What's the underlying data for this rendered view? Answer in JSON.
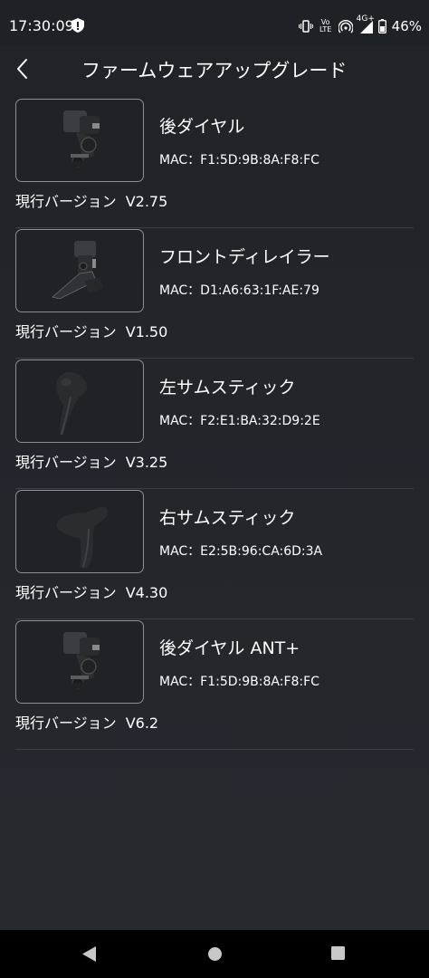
{
  "status_bar": {
    "time": "17:30:09",
    "network": "4G+",
    "volte": "Vo LTE",
    "battery": "46%",
    "icons": [
      "shield-alert-icon",
      "vibrate-icon",
      "volte-icon",
      "hotspot-icon",
      "signal-icon",
      "battery-icon"
    ]
  },
  "header": {
    "title": "ファームウェアアップグレード",
    "back_icon": "chevron-left-icon"
  },
  "devices": [
    {
      "name": "後ダイヤル",
      "mac": "MAC：F1:5D:9B:8A:F8:FC",
      "version_label": "現行バージョン",
      "version": "V2.75",
      "image": "rear-derailleur-image"
    },
    {
      "name": "フロントディレイラー",
      "mac": "MAC：D1:A6:63:1F:AE:79",
      "version_label": "現行バージョン",
      "version": "V1.50",
      "image": "front-derailleur-image"
    },
    {
      "name": "左サムスティック",
      "mac": "MAC：F2:E1:BA:32:D9:2E",
      "version_label": "現行バージョン",
      "version": "V3.25",
      "image": "left-shifter-image"
    },
    {
      "name": "右サムスティック",
      "mac": "MAC：E2:5B:96:CA:6D:3A",
      "version_label": "現行バージョン",
      "version": "V4.30",
      "image": "right-shifter-image"
    },
    {
      "name": "後ダイヤル ANT+",
      "mac": "MAC：F1:5D:9B:8A:F8:FC",
      "version_label": "現行バージョン",
      "version": "V6.2",
      "image": "rear-derailleur-image"
    }
  ],
  "nav_bar": {
    "icons": [
      "back-triangle-icon",
      "home-circle-icon",
      "recents-square-icon"
    ]
  }
}
